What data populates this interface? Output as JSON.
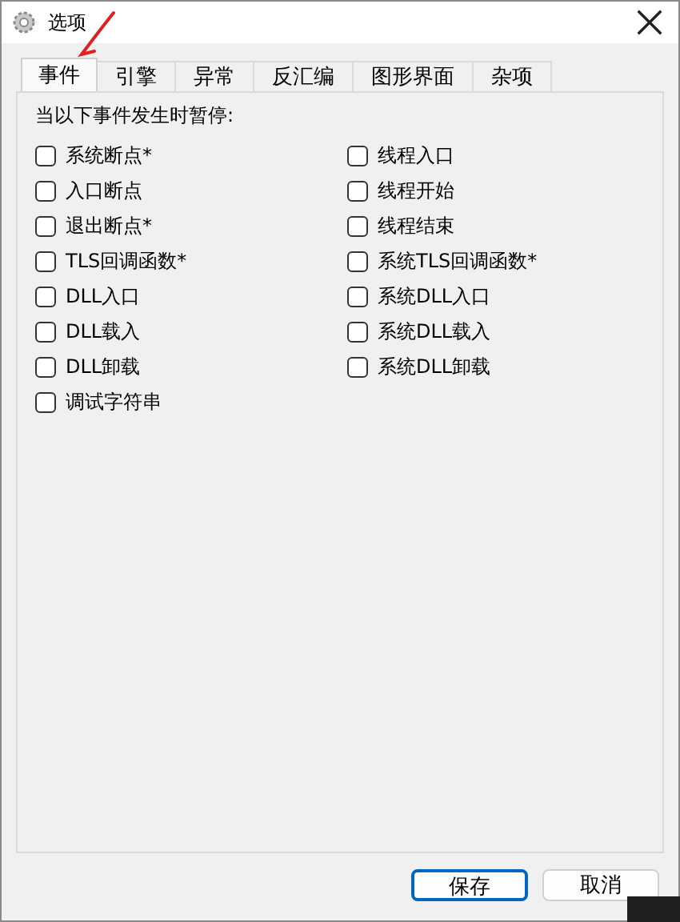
{
  "window": {
    "title": "选项"
  },
  "tabs": [
    {
      "label": "事件",
      "selected": true
    },
    {
      "label": "引擎",
      "selected": false
    },
    {
      "label": "异常",
      "selected": false
    },
    {
      "label": "反汇编",
      "selected": false
    },
    {
      "label": "图形界面",
      "selected": false
    },
    {
      "label": "杂项",
      "selected": false
    }
  ],
  "heading": "当以下事件发生时暂停:",
  "left_column": [
    {
      "label": "系统断点*",
      "checked": false
    },
    {
      "label": "入口断点",
      "checked": false
    },
    {
      "label": "退出断点*",
      "checked": false
    },
    {
      "label": "TLS回调函数*",
      "checked": false
    },
    {
      "label": "DLL入口",
      "checked": false
    },
    {
      "label": "DLL载入",
      "checked": false
    },
    {
      "label": "DLL卸载",
      "checked": false
    },
    {
      "label": "调试字符串",
      "checked": false
    }
  ],
  "right_column": [
    {
      "label": "线程入口",
      "checked": false
    },
    {
      "label": "线程开始",
      "checked": false
    },
    {
      "label": "线程结束",
      "checked": false
    },
    {
      "label": "系统TLS回调函数*",
      "checked": false
    },
    {
      "label": "系统DLL入口",
      "checked": false
    },
    {
      "label": "系统DLL载入",
      "checked": false
    },
    {
      "label": "系统DLL卸载",
      "checked": false
    }
  ],
  "buttons": [
    {
      "label": "保存",
      "kind": "default"
    },
    {
      "label": "取消",
      "kind": "normal"
    }
  ]
}
